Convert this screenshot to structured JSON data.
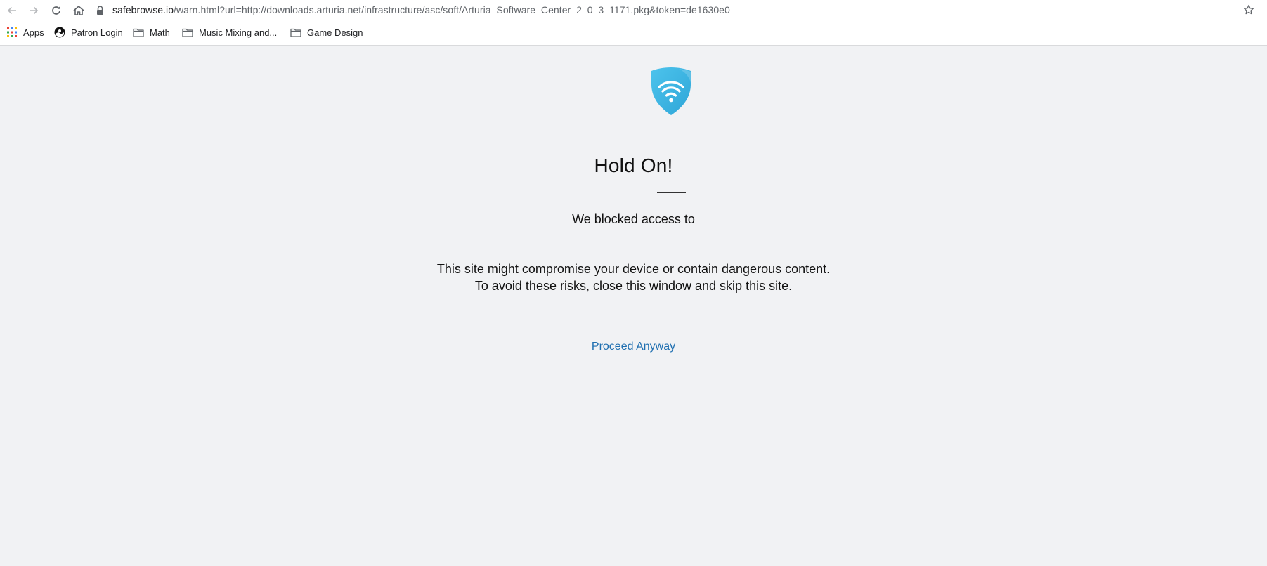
{
  "browser": {
    "url_host": "safebrowse.io",
    "url_rest": "/warn.html?url=http://downloads.arturia.net/infrastructure/asc/soft/Arturia_Software_Center_2_0_3_1171.pkg&token=de1630e0"
  },
  "bookmarks": [
    {
      "label": "Apps",
      "icon": "apps-grid-icon"
    },
    {
      "label": "Patron Login",
      "icon": "site-favicon"
    },
    {
      "label": "Math",
      "icon": "folder-icon"
    },
    {
      "label": "Music Mixing and...",
      "icon": "folder-icon"
    },
    {
      "label": "Game Design",
      "icon": "folder-icon"
    }
  ],
  "warning": {
    "title": "Hold On!",
    "blocked_text": "We blocked access to",
    "message_line1": "This site might compromise your device or contain dangerous content.",
    "message_line2": "To avoid these risks, close this window and skip this site.",
    "proceed_label": "Proceed Anyway"
  },
  "colors": {
    "background": "#f1f2f4",
    "shield": "#3cb4e3",
    "link": "#1f6fb0"
  }
}
